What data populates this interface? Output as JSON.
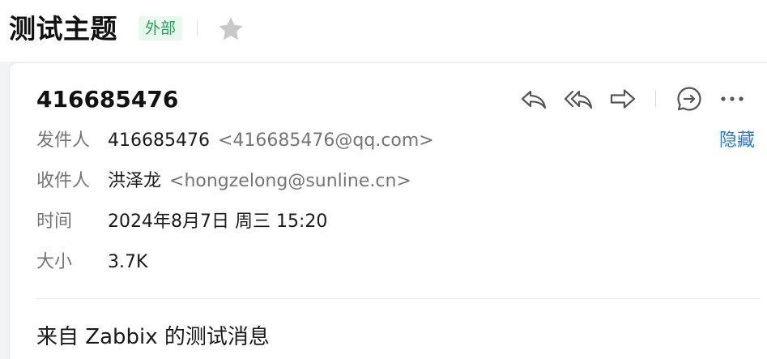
{
  "header": {
    "subject": "测试主题",
    "tag": "外部",
    "star_icon": "star-outline-icon",
    "star_color": "#c8c8c8",
    "tag_bg": "#e9f8ee",
    "tag_color": "#25a15a"
  },
  "message": {
    "sender_title": "416685476",
    "actions": [
      {
        "name": "reply-icon"
      },
      {
        "name": "reply-all-icon"
      },
      {
        "name": "forward-icon"
      },
      {
        "name": "chat-reply-icon"
      },
      {
        "name": "more-icon"
      }
    ],
    "hide_label": "隐藏",
    "link_color": "#2b79d6",
    "fields": {
      "from": {
        "label": "发件人",
        "name": "416685476",
        "address": "<416685476@qq.com>"
      },
      "to": {
        "label": "收件人",
        "name": "洪泽龙",
        "address": "<hongzelong@sunline.cn>"
      },
      "time": {
        "label": "时间",
        "value": "2024年8月7日 周三 15:20"
      },
      "size": {
        "label": "大小",
        "value": "3.7K"
      }
    },
    "body": "来自 Zabbix 的测试消息"
  }
}
